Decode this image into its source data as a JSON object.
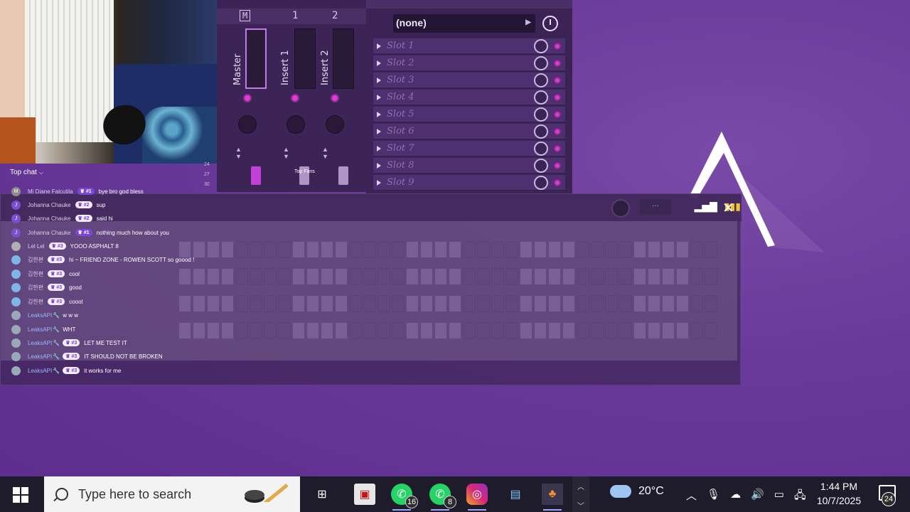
{
  "chat": {
    "header": "Top chat",
    "messages": [
      {
        "avatar": "M",
        "user": "Mi Diane Falcutila",
        "badge": "#1",
        "text": "bye bro god bless"
      },
      {
        "avatar": "J",
        "user": "Johanna Chauke",
        "badge": "#2",
        "text": "sup"
      },
      {
        "avatar": "J",
        "user": "Johanna Chauke",
        "badge": "#2",
        "text": "said hi"
      },
      {
        "avatar": "J",
        "user": "Johanna Chauke",
        "badge": "#1",
        "text": "nothing much how about you"
      },
      {
        "avatar": "",
        "user": "Lel Lel",
        "badge": "#3",
        "text": "YOOO ASPHALT 8"
      },
      {
        "avatar": "",
        "user": "김한편",
        "badge": "#3",
        "text": "hi ~ FRIEND ZONE - ROWEN SCOTT so goood !"
      },
      {
        "avatar": "",
        "user": "김한편",
        "badge": "#3",
        "text": "cool"
      },
      {
        "avatar": "",
        "user": "김한편",
        "badge": "#3",
        "text": "good"
      },
      {
        "avatar": "",
        "user": "김한편",
        "badge": "#3",
        "text": "coool"
      },
      {
        "avatar": "",
        "user": "LeaksAPI",
        "badge": "",
        "text": "w w w"
      },
      {
        "avatar": "",
        "user": "LeaksAPI",
        "badge": "",
        "text": "WHT"
      },
      {
        "avatar": "",
        "user": "LeaksAPI",
        "badge": "#3",
        "text": "LET ME TEST IT"
      },
      {
        "avatar": "",
        "user": "LeaksAPI",
        "badge": "#3",
        "text": "IT SHOULD NOT BE BROKEN"
      },
      {
        "avatar": "",
        "user": "LeaksAPI",
        "badge": "#3",
        "text": "it works for me"
      }
    ],
    "top_fans": "Top Fans"
  },
  "mixer": {
    "master_button": "M",
    "col1": "1",
    "col2": "2",
    "strip_master": "Master",
    "strip_1": "Insert 1",
    "strip_2": "Insert 2",
    "rows": [
      "24",
      "27",
      "30"
    ]
  },
  "slots": {
    "preset": "(none)",
    "items": [
      "Slot 1",
      "Slot 2",
      "Slot 3",
      "Slot 4",
      "Slot 5",
      "Slot 6",
      "Slot 7",
      "Slot 8",
      "Slot 9"
    ]
  },
  "sequencer": {
    "dots_label": "···"
  },
  "taskbar": {
    "search_placeholder": "Type here to search",
    "whatsapp_1_count": "16",
    "whatsapp_2_count": "8",
    "weather": "20°C",
    "time": "1:44 PM",
    "date": "10/7/2025",
    "notifications": "24"
  },
  "colors": {
    "accent": "#e23ad8",
    "background": "#6a3a9a",
    "taskbar": "#1e1b2b"
  }
}
